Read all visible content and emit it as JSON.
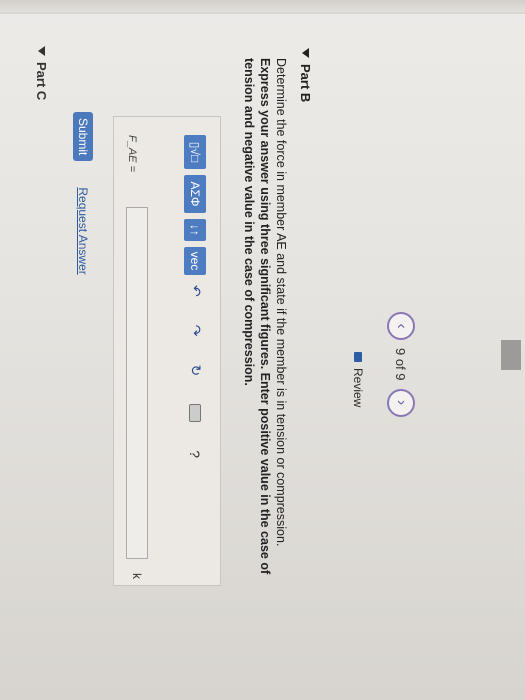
{
  "nav": {
    "prev_symbol": "‹",
    "next_symbol": "›",
    "position_text": "9 of 9"
  },
  "review": {
    "label": "Review"
  },
  "part_b": {
    "title": "Part B",
    "prompt_line1": "Determine the force in member AE and state if the member is in tension or compression.",
    "prompt_line2": "Express your answer using three significant figures. Enter positive value in the case of",
    "prompt_line3": "tension and negative value in the case of compression."
  },
  "toolbar": {
    "btn_template": "▯√□",
    "btn_greek": "ΑΣΦ",
    "btn_arrows": "↓↑",
    "btn_vec": "vec",
    "undo_symbol": "↶",
    "redo_symbol": "↷",
    "reset_symbol": "↻",
    "help_symbol": "?"
  },
  "answer": {
    "label": "F_AE =",
    "value": "",
    "unit": "k"
  },
  "actions": {
    "submit_label": "Submit",
    "request_label": "Request Answer"
  },
  "part_c": {
    "title": "Part C"
  },
  "colors": {
    "accent": "#4b79bb",
    "nav_purple": "#8a78b6",
    "link_blue": "#2f5c9e"
  }
}
